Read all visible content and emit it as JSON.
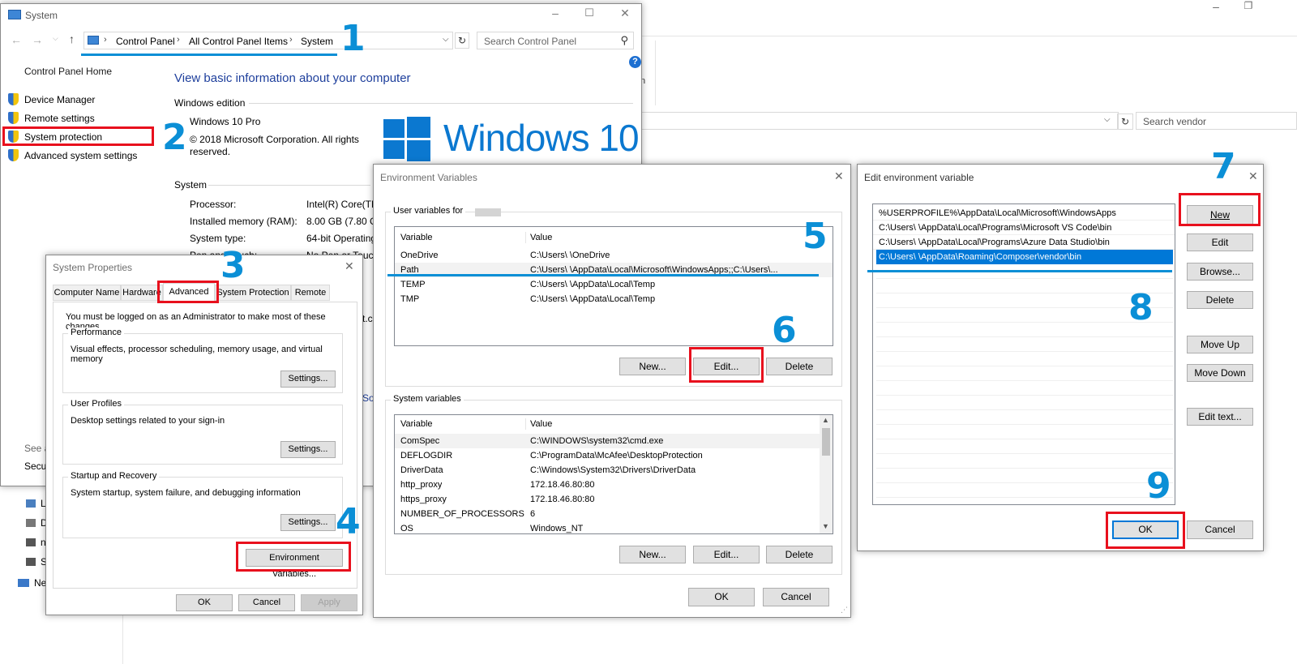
{
  "system_window": {
    "title": "System",
    "breadcrumb": [
      "Control Panel",
      "All Control Panel Items",
      "System"
    ],
    "search_placeholder": "Search Control Panel",
    "nav_home": "Control Panel Home",
    "nav_links": [
      "Device Manager",
      "Remote settings",
      "System protection",
      "Advanced system settings"
    ],
    "heading": "View basic information about your computer",
    "edition_section": "Windows edition",
    "edition_name": "Windows 10 Pro",
    "copyright": "© 2018 Microsoft Corporation. All rights reserved.",
    "logo_text": "Windows 10",
    "system_section": "System",
    "specs": [
      {
        "label": "Processor:",
        "value": "Intel(R) Core(TM"
      },
      {
        "label": "Installed memory (RAM):",
        "value": "8.00 GB (7.80 GB"
      },
      {
        "label": "System type:",
        "value": "64-bit Operating"
      },
      {
        "label": "Pen and Touch:",
        "value": "No Pen or Touch"
      }
    ],
    "see_also": "See a",
    "security": "Secur"
  },
  "background_explorer": {
    "search_placeholder": "Search vendor",
    "partial_text": "n",
    "tree_items": [
      "L",
      "D",
      "n",
      "S",
      "Ne"
    ]
  },
  "system_properties": {
    "title": "System Properties",
    "tabs": [
      "Computer Name",
      "Hardware",
      "Advanced",
      "System Protection",
      "Remote"
    ],
    "admin_note": "You must be logged on as an Administrator to make most of these changes.",
    "performance_label": "Performance",
    "performance_desc": "Visual effects, processor scheduling, memory usage, and virtual memory",
    "profiles_label": "User Profiles",
    "profiles_desc": "Desktop settings related to your sign-in",
    "startup_label": "Startup and Recovery",
    "startup_desc": "System startup, system failure, and debugging information",
    "settings_btn": "Settings...",
    "env_btn": "Environment Variables...",
    "ok": "OK",
    "cancel": "Cancel",
    "apply": "Apply",
    "bg_fragment": "t.c",
    "bg_fragment2": "So"
  },
  "env_vars": {
    "title": "Environment Variables",
    "user_section": "User variables for",
    "col_variable": "Variable",
    "col_value": "Value",
    "user_rows": [
      {
        "name": "OneDrive",
        "value": "C:\\Users\\        \\OneDrive"
      },
      {
        "name": "Path",
        "value": "C:\\Users\\        \\AppData\\Local\\Microsoft\\WindowsApps;;C:\\Users\\..."
      },
      {
        "name": "TEMP",
        "value": "C:\\Users\\        \\AppData\\Local\\Temp"
      },
      {
        "name": "TMP",
        "value": "C:\\Users\\        \\AppData\\Local\\Temp"
      }
    ],
    "system_section": "System variables",
    "system_rows": [
      {
        "name": "ComSpec",
        "value": "C:\\WINDOWS\\system32\\cmd.exe"
      },
      {
        "name": "DEFLOGDIR",
        "value": "C:\\ProgramData\\McAfee\\DesktopProtection"
      },
      {
        "name": "DriverData",
        "value": "C:\\Windows\\System32\\Drivers\\DriverData"
      },
      {
        "name": "http_proxy",
        "value": "172.18.46.80:80"
      },
      {
        "name": "https_proxy",
        "value": "172.18.46.80:80"
      },
      {
        "name": "NUMBER_OF_PROCESSORS",
        "value": "6"
      },
      {
        "name": "OS",
        "value": "Windows_NT"
      }
    ],
    "new_btn": "New...",
    "edit_btn": "Edit...",
    "delete_btn": "Delete",
    "ok": "OK",
    "cancel": "Cancel"
  },
  "edit_env": {
    "title": "Edit environment variable",
    "entries": [
      "%USERPROFILE%\\AppData\\Local\\Microsoft\\WindowsApps",
      "C:\\Users\\        \\AppData\\Local\\Programs\\Microsoft VS Code\\bin",
      "C:\\Users\\        \\AppData\\Local\\Programs\\Azure Data Studio\\bin",
      "C:\\Users\\        \\AppData\\Roaming\\Composer\\vendor\\bin"
    ],
    "new_btn": "New",
    "edit_btn": "Edit",
    "browse_btn": "Browse...",
    "delete_btn": "Delete",
    "move_up_btn": "Move Up",
    "move_down_btn": "Move Down",
    "edit_text_btn": "Edit text...",
    "ok": "OK",
    "cancel": "Cancel"
  },
  "step_numbers": [
    "1",
    "2",
    "3",
    "4",
    "5",
    "6",
    "7",
    "8",
    "9"
  ],
  "colors": {
    "accent": "#0b8fd6",
    "highlight": "#e8101d",
    "selection": "#0078d7"
  }
}
